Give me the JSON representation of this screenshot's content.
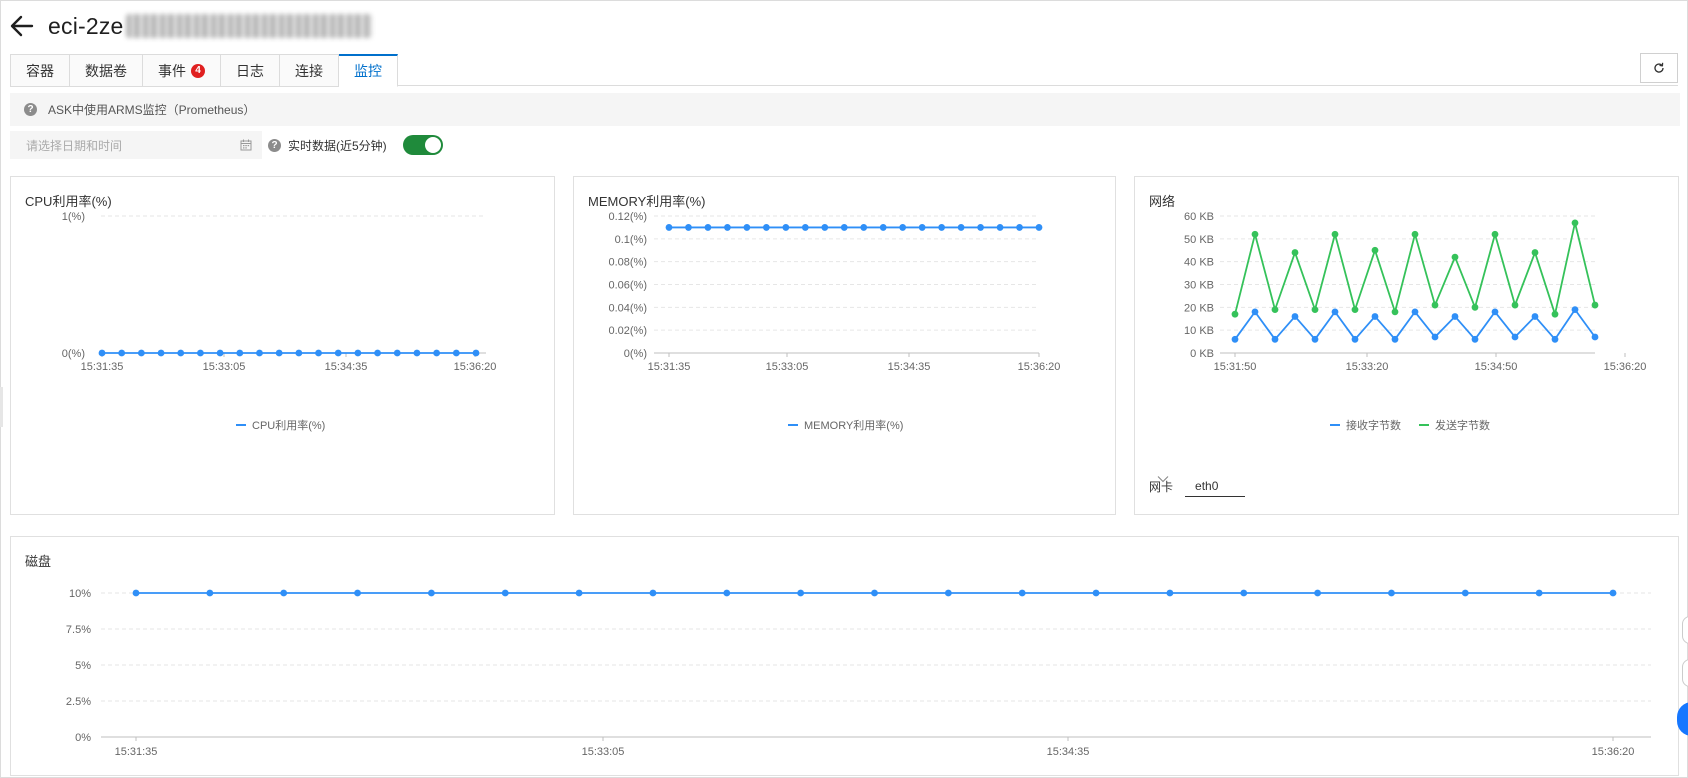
{
  "header": {
    "title": "eci-2ze"
  },
  "tabs": [
    {
      "label": "容器",
      "badge": ""
    },
    {
      "label": "数据卷",
      "badge": ""
    },
    {
      "label": "事件",
      "badge": "4"
    },
    {
      "label": "日志",
      "badge": ""
    },
    {
      "label": "连接",
      "badge": ""
    },
    {
      "label": "监控",
      "badge": ""
    }
  ],
  "info": {
    "text": "ASK中使用ARMS监控（Prometheus）"
  },
  "filters": {
    "date_placeholder": "请选择日期和时间",
    "realtime_label": "实时数据(近5分钟)",
    "realtime_on": true
  },
  "colors": {
    "accent": "#0070cc",
    "series_blue": "#2f8ff7",
    "series_green": "#35c25a",
    "toggle": "#1f8a3b"
  },
  "charts": {
    "cpu": {
      "title": "CPU利用率(%)",
      "chart_data": {
        "type": "line",
        "y_ticks": [
          "0(%)",
          "1(%)"
        ],
        "x_ticks": [
          "15:31:35",
          "15:33:05",
          "15:34:35",
          "15:36:20"
        ],
        "ylim": [
          0,
          1
        ],
        "series": [
          {
            "name": "CPU利用率(%)",
            "values": [
              0,
              0,
              0,
              0,
              0,
              0,
              0,
              0,
              0,
              0,
              0,
              0,
              0,
              0,
              0,
              0,
              0,
              0,
              0,
              0
            ]
          }
        ]
      }
    },
    "memory": {
      "title": "MEMORY利用率(%)",
      "chart_data": {
        "type": "line",
        "y_ticks": [
          "0(%)",
          "0.02(%)",
          "0.04(%)",
          "0.06(%)",
          "0.08(%)",
          "0.1(%)",
          "0.12(%)"
        ],
        "x_ticks": [
          "15:31:35",
          "15:33:05",
          "15:34:35",
          "15:36:20"
        ],
        "ylim": [
          0,
          0.12
        ],
        "series": [
          {
            "name": "MEMORY利用率(%)",
            "values": [
              0.11,
              0.11,
              0.11,
              0.11,
              0.11,
              0.11,
              0.11,
              0.11,
              0.11,
              0.11,
              0.11,
              0.11,
              0.11,
              0.11,
              0.11,
              0.11,
              0.11,
              0.11,
              0.11,
              0.11
            ]
          }
        ]
      }
    },
    "network": {
      "title": "网络",
      "chart_data": {
        "type": "line",
        "y_ticks": [
          "0 KB",
          "10 KB",
          "20 KB",
          "30 KB",
          "40 KB",
          "50 KB",
          "60 KB"
        ],
        "x_ticks": [
          "15:31:50",
          "15:33:20",
          "15:34:50",
          "15:36:20"
        ],
        "ylim": [
          0,
          60
        ],
        "series": [
          {
            "name": "接收字节数",
            "values": [
              6,
              18,
              6,
              16,
              6,
              18,
              6,
              16,
              6,
              18,
              7,
              16,
              6,
              18,
              7,
              16,
              6,
              19,
              7
            ]
          },
          {
            "name": "发送字节数",
            "values": [
              17,
              52,
              19,
              44,
              19,
              52,
              19,
              45,
              18,
              52,
              21,
              42,
              20,
              52,
              21,
              44,
              17,
              57,
              21
            ]
          }
        ]
      },
      "nic_label": "网卡",
      "nic_value": "eth0"
    },
    "disk": {
      "title": "磁盘",
      "chart_data": {
        "type": "line",
        "y_ticks": [
          "0%",
          "2.5%",
          "5%",
          "7.5%",
          "10%"
        ],
        "x_ticks": [
          "15:31:35",
          "15:33:05",
          "15:34:35",
          "15:36:20"
        ],
        "ylim": [
          0,
          10
        ],
        "series": [
          {
            "name": "",
            "values": [
              10,
              10,
              10,
              10,
              10,
              10,
              10,
              10,
              10,
              10,
              10,
              10,
              10,
              10,
              10,
              10,
              10,
              10,
              10,
              10,
              10
            ]
          }
        ]
      }
    }
  }
}
